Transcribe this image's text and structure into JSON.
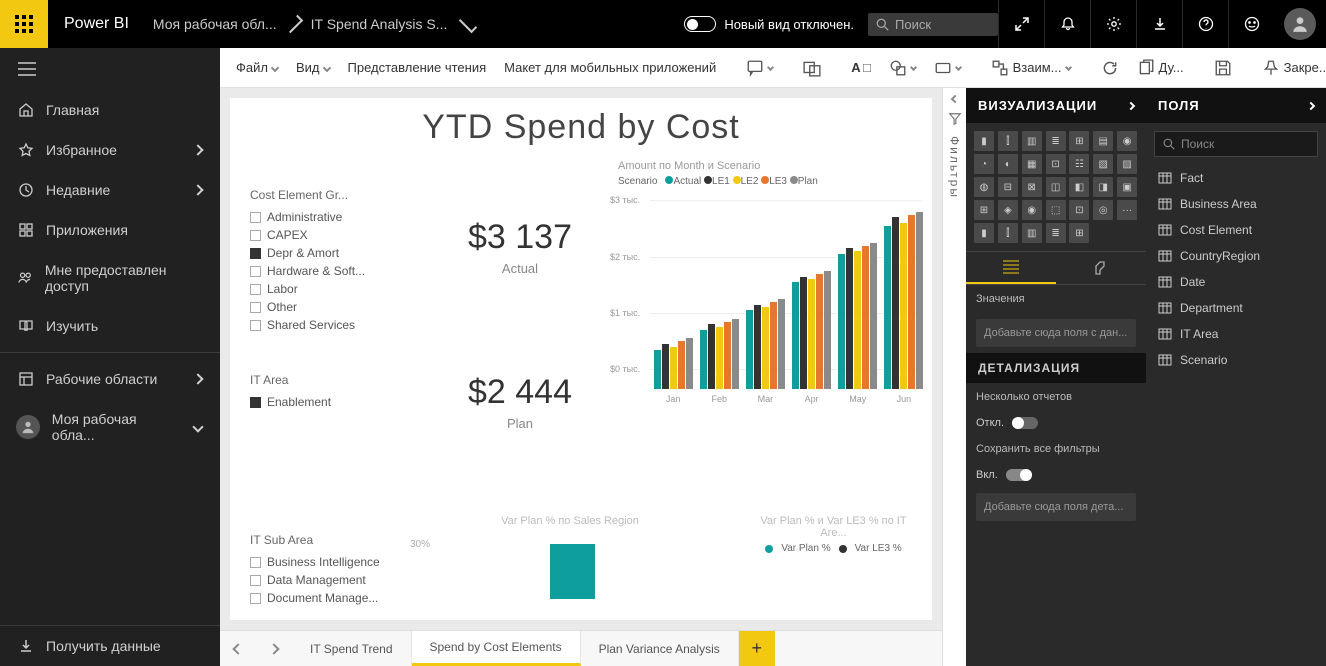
{
  "brand": "Power BI",
  "breadcrumb": {
    "workspace": "Моя рабочая обл...",
    "report": "IT Spend Analysis S..."
  },
  "new_look": "Новый вид отключен.",
  "search_placeholder": "Поиск",
  "nav": {
    "home": "Главная",
    "fav": "Избранное",
    "recent": "Недавние",
    "apps": "Приложения",
    "shared": "Мне предоставлен доступ",
    "learn": "Изучить",
    "workspaces": "Рабочие области",
    "myws": "Моя рабочая обла...",
    "getdata": "Получить данные"
  },
  "ribbon": {
    "file": "Файл",
    "view": "Вид",
    "reading": "Представление чтения",
    "mobile": "Макет для мобильных приложений",
    "interactions": "Взаим...",
    "dup": "Ду...",
    "pin": "Закре..."
  },
  "report": {
    "title": "YTD Spend by Cost",
    "cost_element": {
      "header": "Cost Element Gr...",
      "items": [
        {
          "label": "Administrative",
          "sel": false
        },
        {
          "label": "CAPEX",
          "sel": false
        },
        {
          "label": "Depr & Amort",
          "sel": true
        },
        {
          "label": "Hardware & Soft...",
          "sel": false
        },
        {
          "label": "Labor",
          "sel": false
        },
        {
          "label": "Other",
          "sel": false
        },
        {
          "label": "Shared Services",
          "sel": false
        }
      ]
    },
    "it_area": {
      "header": "IT Area",
      "items": [
        {
          "label": "Enablement",
          "sel": true
        }
      ]
    },
    "it_sub": {
      "header": "IT Sub Area",
      "items": [
        {
          "label": "Business Intelligence",
          "sel": false
        },
        {
          "label": "Data Management",
          "sel": false
        },
        {
          "label": "Document Manage...",
          "sel": false
        }
      ]
    },
    "kpi1": {
      "value": "$3 137",
      "label": "Actual"
    },
    "kpi2": {
      "value": "$2 444",
      "label": "Plan"
    },
    "chart2_title": "Var Plan % по Sales Region",
    "chart2_axis": "30%",
    "chart3_title": "Var Plan % и Var LE3 % по IT Are...",
    "chart3_legend": {
      "a": "Var Plan %",
      "b": "Var LE3 %"
    }
  },
  "chart_data": {
    "type": "bar",
    "title": "Amount по Month и Scenario",
    "legend_label": "Scenario",
    "series": [
      {
        "name": "Actual",
        "color": "#0e9e9e"
      },
      {
        "name": "LE1",
        "color": "#333333"
      },
      {
        "name": "LE2",
        "color": "#f2c811"
      },
      {
        "name": "LE3",
        "color": "#e8762d"
      },
      {
        "name": "Plan",
        "color": "#8a8a8a"
      }
    ],
    "categories": [
      "Jan",
      "Feb",
      "Mar",
      "Apr",
      "May",
      "Jun"
    ],
    "values": {
      "Actual": [
        700,
        1050,
        1400,
        1900,
        2400,
        2900
      ],
      "LE1": [
        800,
        1150,
        1500,
        2000,
        2500,
        3050
      ],
      "LE2": [
        750,
        1100,
        1450,
        1950,
        2450,
        2950
      ],
      "LE3": [
        850,
        1200,
        1550,
        2050,
        2550,
        3100
      ],
      "Plan": [
        900,
        1250,
        1600,
        2100,
        2600,
        3150
      ]
    },
    "ylabel_unit": "тыс.",
    "ylim": [
      0,
      3200
    ],
    "yticks": [
      "$0 тыс.",
      "$1 тыс.",
      "$2 тыс.",
      "$3 тыс."
    ]
  },
  "tabs": {
    "t1": "IT Spend Trend",
    "t2": "Spend by Cost Elements",
    "t3": "Plan Variance Analysis"
  },
  "filters_label": "Фильтры",
  "viz_panel": {
    "title": "ВИЗУАЛИЗАЦИИ",
    "values": "Значения",
    "drop1": "Добавьте сюда поля с дан...",
    "detail": "ДЕТАЛИЗАЦИЯ",
    "multi": "Несколько отчетов",
    "off": "Откл.",
    "keep": "Сохранить все фильтры",
    "on": "Вкл.",
    "drop2": "Добавьте сюда поля дета..."
  },
  "fields_panel": {
    "title": "ПОЛЯ",
    "search": "Поиск",
    "tables": [
      "Fact",
      "Business Area",
      "Cost Element",
      "CountryRegion",
      "Date",
      "Department",
      "IT Area",
      "Scenario"
    ]
  }
}
